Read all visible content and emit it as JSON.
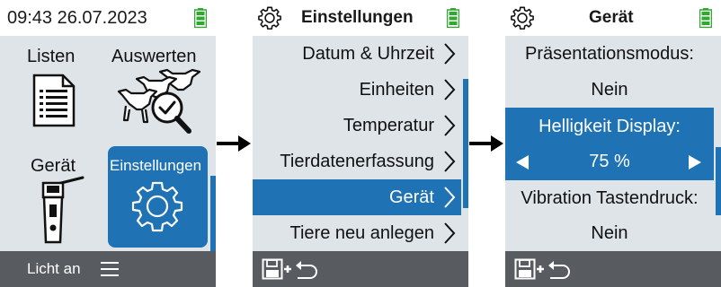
{
  "colors": {
    "accent": "#1f73b4",
    "screen_bg": "#dfe4e9",
    "bottom_bar": "#585c60",
    "battery": "#2faa2f"
  },
  "screen1": {
    "datetime": "09:43 26.07.2023",
    "tiles": {
      "listen": {
        "label": "Listen",
        "icon": "list-document-icon"
      },
      "auswerten": {
        "label": "Auswerten",
        "icon": "cows-magnifier-icon"
      },
      "geraet": {
        "label": "Gerät",
        "icon": "handheld-reader-icon"
      },
      "einstellungen": {
        "label": "Einstellungen",
        "icon": "gear-icon"
      }
    },
    "bottom": {
      "light_label": "Licht an",
      "menu_icon": "hamburger-menu-icon"
    }
  },
  "screen2": {
    "title": "Einstellungen",
    "items": [
      {
        "label": "Datum & Uhrzeit"
      },
      {
        "label": "Einheiten"
      },
      {
        "label": "Temperatur"
      },
      {
        "label": "Tierdatenerfassung"
      },
      {
        "label": "Gerät"
      },
      {
        "label": "Tiere neu anlegen"
      }
    ],
    "selected_index": 4,
    "bottom": {
      "icon": "save-plus-back-icon"
    }
  },
  "screen3": {
    "title": "Gerät",
    "params": {
      "presentation_label": "Präsentationsmodus:",
      "presentation_value": "Nein",
      "brightness_label": "Helligkeit Display:",
      "brightness_value": "75 %",
      "vibration_label": "Vibration Tastendruck:",
      "vibration_value": "Nein"
    },
    "bottom": {
      "icon": "save-plus-back-icon"
    }
  }
}
